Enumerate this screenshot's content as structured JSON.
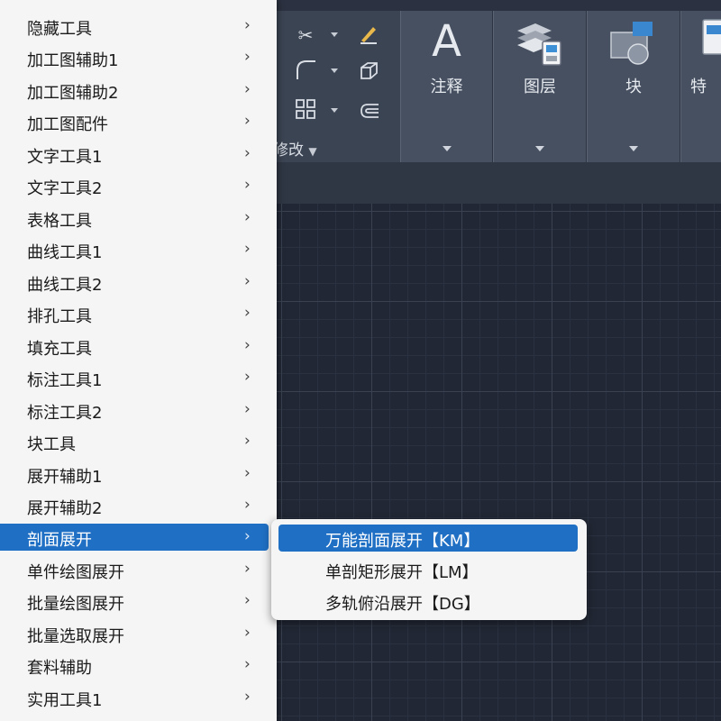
{
  "ribbon": {
    "panels": [
      {
        "label": "注释",
        "icon": "letter-a-icon"
      },
      {
        "label": "图层",
        "icon": "layers-icon"
      },
      {
        "label": "块",
        "icon": "block-icon"
      },
      {
        "label": "特",
        "icon": "properties-icon"
      }
    ],
    "modify_label": "修改"
  },
  "main_menu": {
    "items": [
      "隐藏工具",
      "加工图辅助1",
      "加工图辅助2",
      "加工图配件",
      "文字工具1",
      "文字工具2",
      "表格工具",
      "曲线工具1",
      "曲线工具2",
      "排孔工具",
      "填充工具",
      "标注工具1",
      "标注工具2",
      "块工具",
      "展开辅助1",
      "展开辅助2",
      "剖面展开",
      "单件绘图展开",
      "批量绘图展开",
      "批量选取展开",
      "套料辅助",
      "实用工具1"
    ],
    "active_item": "剖面展开",
    "arrow_glyph": "›"
  },
  "submenu": {
    "items": [
      "万能剖面展开【KM】",
      "单剖矩形展开【LM】",
      "多轨俯沿展开【DG】"
    ],
    "active_item": "万能剖面展开【KM】"
  },
  "colors": {
    "menu_bg": "#f5f5f5",
    "highlight": "#1f6fc4",
    "ribbon_bg": "#3b4453",
    "canvas_bg": "#212734"
  }
}
